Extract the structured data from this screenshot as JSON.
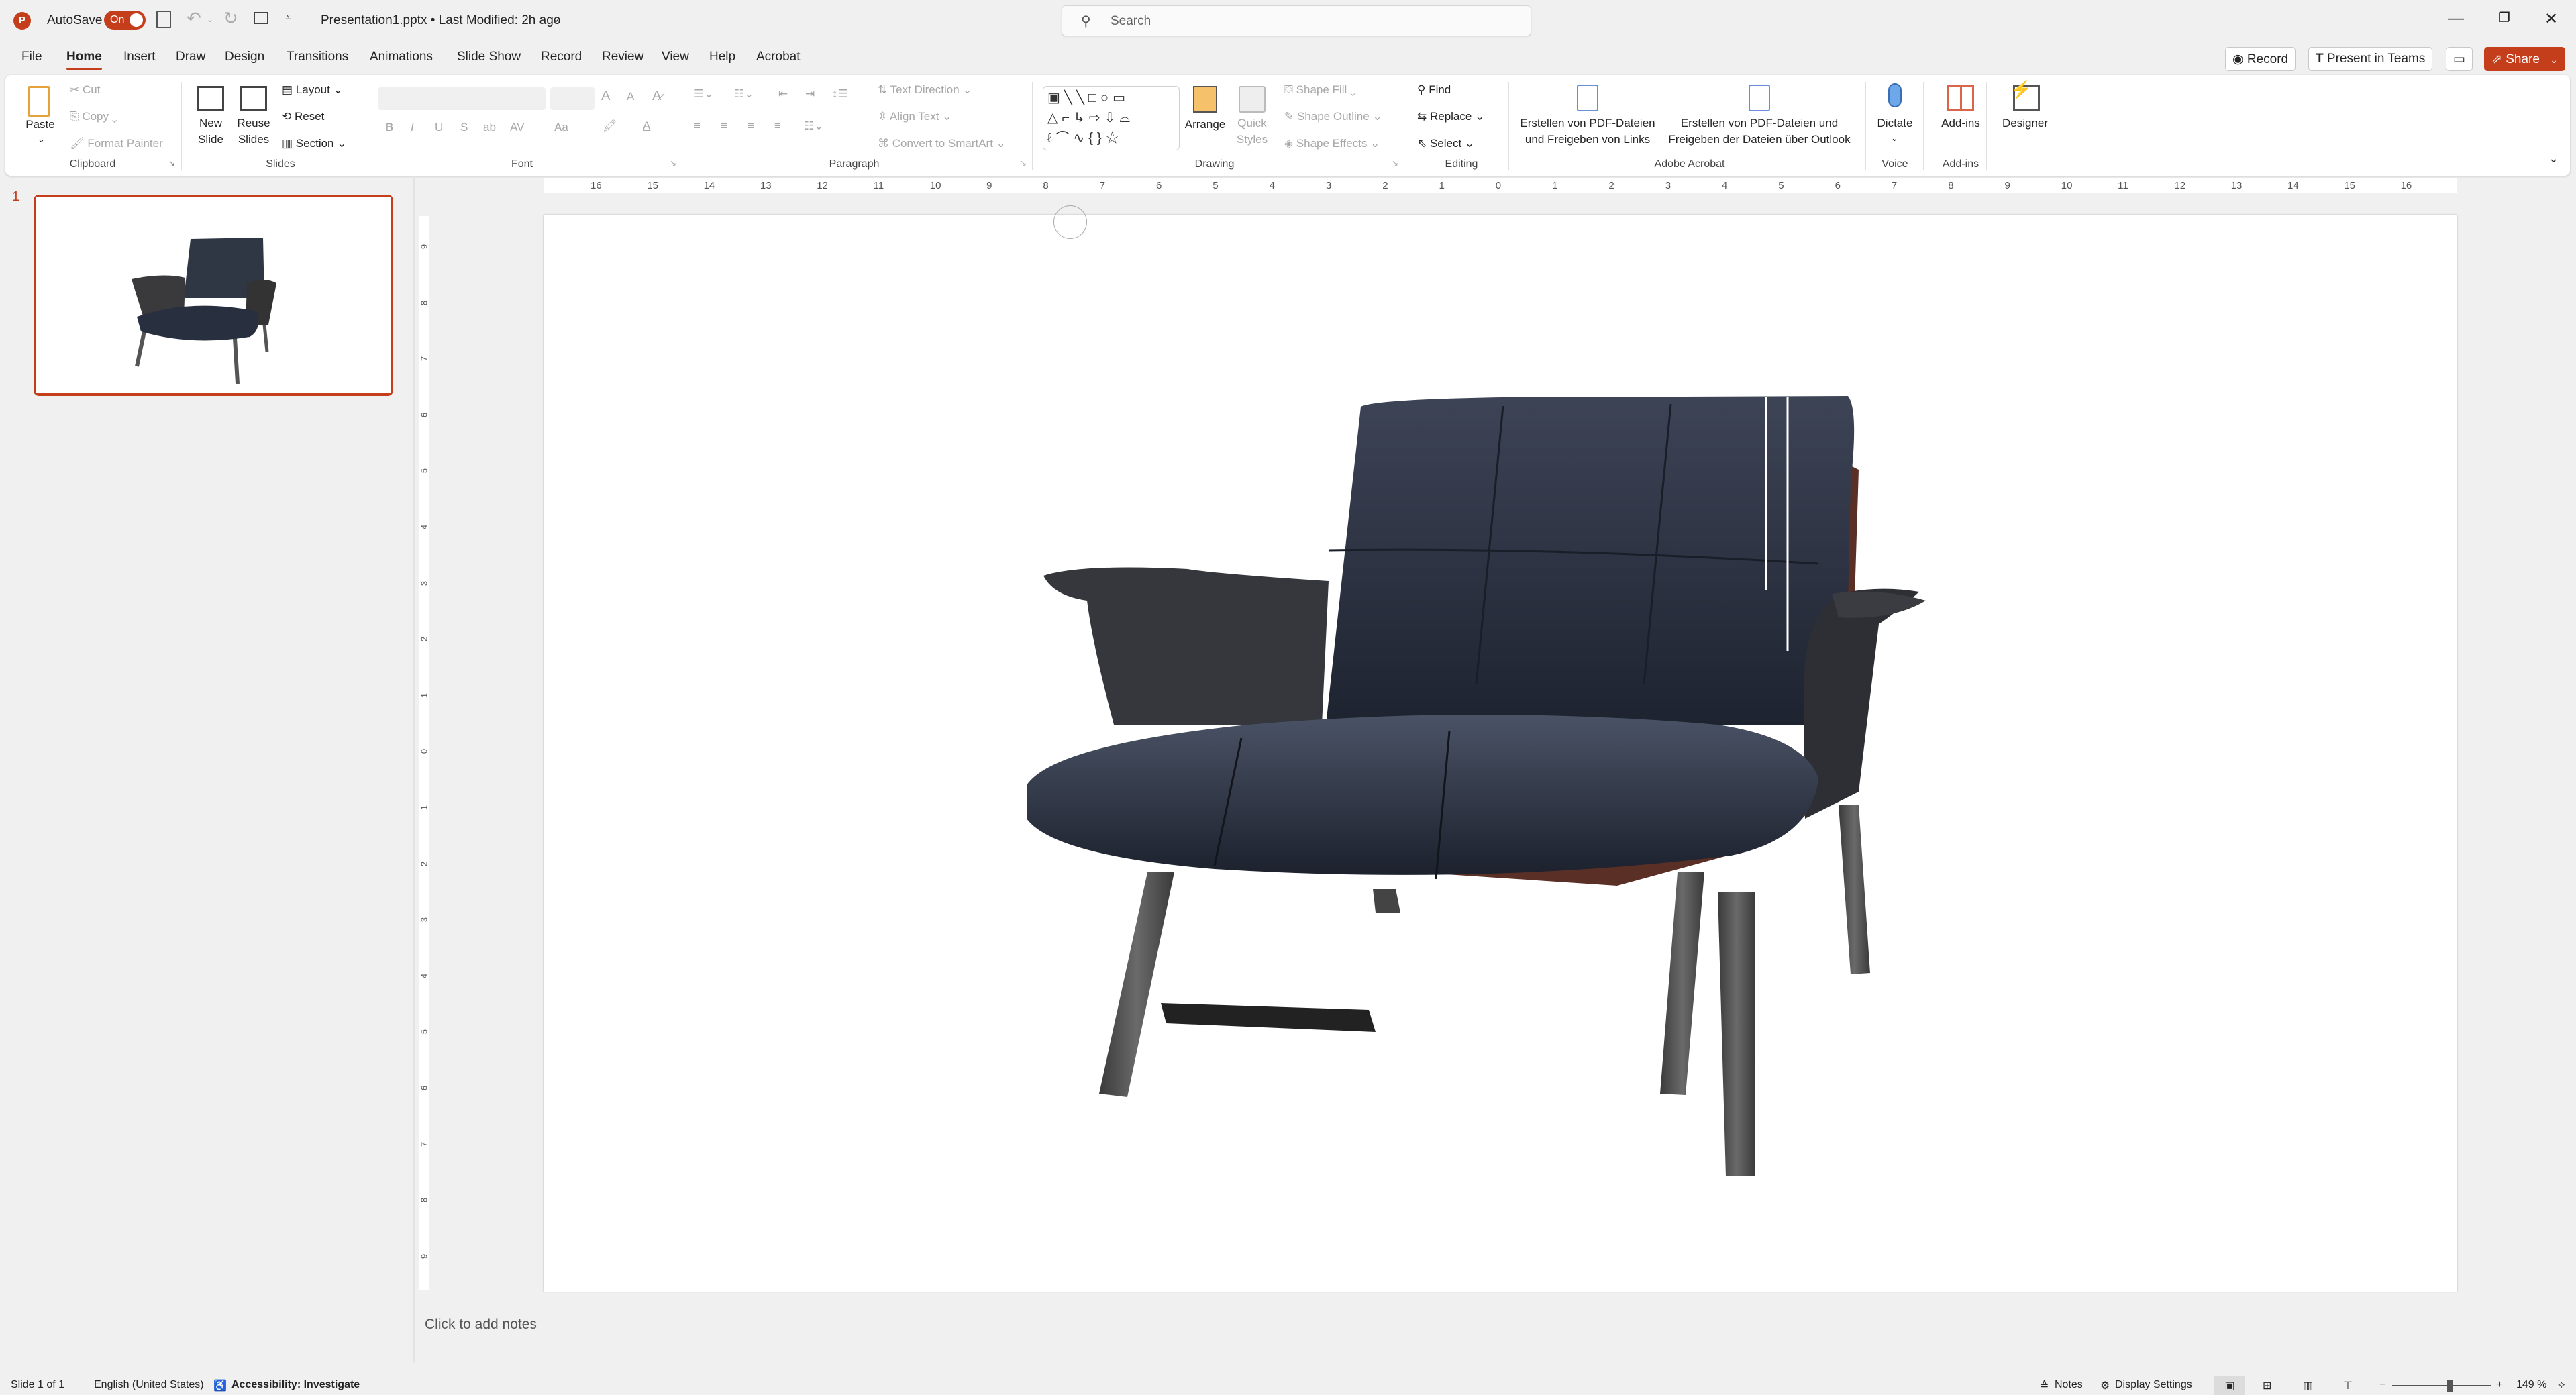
{
  "titlebar": {
    "autosave_label": "AutoSave",
    "autosave_state": "On",
    "doc_title": "Presentation1.pptx • Last Modified: 2h ago",
    "search_placeholder": "Search",
    "minimize": "—",
    "restore": "❐",
    "close": "✕"
  },
  "tabs": [
    "File",
    "Home",
    "Insert",
    "Draw",
    "Design",
    "Transitions",
    "Animations",
    "Slide Show",
    "Record",
    "Review",
    "View",
    "Help",
    "Acrobat"
  ],
  "active_tab": "Home",
  "top_buttons": {
    "record": "Record",
    "present_in_teams": "Present in Teams",
    "share": "Share"
  },
  "ribbon": {
    "clipboard": {
      "paste": "Paste",
      "cut": "Cut",
      "copy": "Copy",
      "format_painter": "Format Painter",
      "label": "Clipboard"
    },
    "slides": {
      "new_slide_1": "New",
      "new_slide_2": "Slide",
      "reuse_1": "Reuse",
      "reuse_2": "Slides",
      "layout": "Layout",
      "reset": "Reset",
      "section": "Section",
      "label": "Slides"
    },
    "font": {
      "label": "Font",
      "bold": "B",
      "italic": "I",
      "underline": "U",
      "shadow": "S",
      "strike": "ab",
      "spacing": "AV",
      "case": "Aa",
      "grow": "A",
      "shrink": "A"
    },
    "paragraph": {
      "text_direction": "Text Direction",
      "align_text": "Align Text",
      "convert_smartart": "Convert to SmartArt",
      "label": "Paragraph"
    },
    "drawing": {
      "arrange": "Arrange",
      "quick_1": "Quick",
      "quick_2": "Styles",
      "shape_fill": "Shape Fill",
      "shape_outline": "Shape Outline",
      "shape_effects": "Shape Effects",
      "label": "Drawing"
    },
    "editing": {
      "find": "Find",
      "replace": "Replace",
      "select": "Select",
      "label": "Editing"
    },
    "acrobat": {
      "btn1_1": "Erstellen von PDF-Dateien",
      "btn1_2": "und Freigeben von Links",
      "btn2_1": "Erstellen von PDF-Dateien und",
      "btn2_2": "Freigeben der Dateien über Outlook",
      "label": "Adobe Acrobat"
    },
    "voice": {
      "dictate": "Dictate",
      "label": "Voice"
    },
    "addins": {
      "addins": "Add-ins",
      "label": "Add-ins"
    },
    "designer": {
      "designer": "Designer"
    }
  },
  "ruler": {
    "horizontal": [
      "16",
      "15",
      "14",
      "13",
      "12",
      "11",
      "10",
      "9",
      "8",
      "7",
      "6",
      "5",
      "4",
      "3",
      "2",
      "1",
      "0",
      "1",
      "2",
      "3",
      "4",
      "5",
      "6",
      "7",
      "8",
      "9",
      "10",
      "11",
      "12",
      "13",
      "14",
      "15",
      "16"
    ],
    "vertical": [
      "9",
      "8",
      "7",
      "6",
      "5",
      "4",
      "3",
      "2",
      "1",
      "0",
      "1",
      "2",
      "3",
      "4",
      "5",
      "6",
      "7",
      "8",
      "9"
    ]
  },
  "thumbnails": [
    {
      "number": "1",
      "content": "leather armchair image"
    }
  ],
  "slide": {
    "image": "3D model of a dark leather lounge armchair with wooden shell and metal legs"
  },
  "notes_placeholder": "Click to add notes",
  "status": {
    "slide_count": "Slide 1 of 1",
    "language": "English (United States)",
    "accessibility": "Accessibility: Investigate",
    "notes": "Notes",
    "display_settings": "Display Settings",
    "zoom_level": "149 %"
  },
  "colors": {
    "accent": "#c43e1c"
  }
}
